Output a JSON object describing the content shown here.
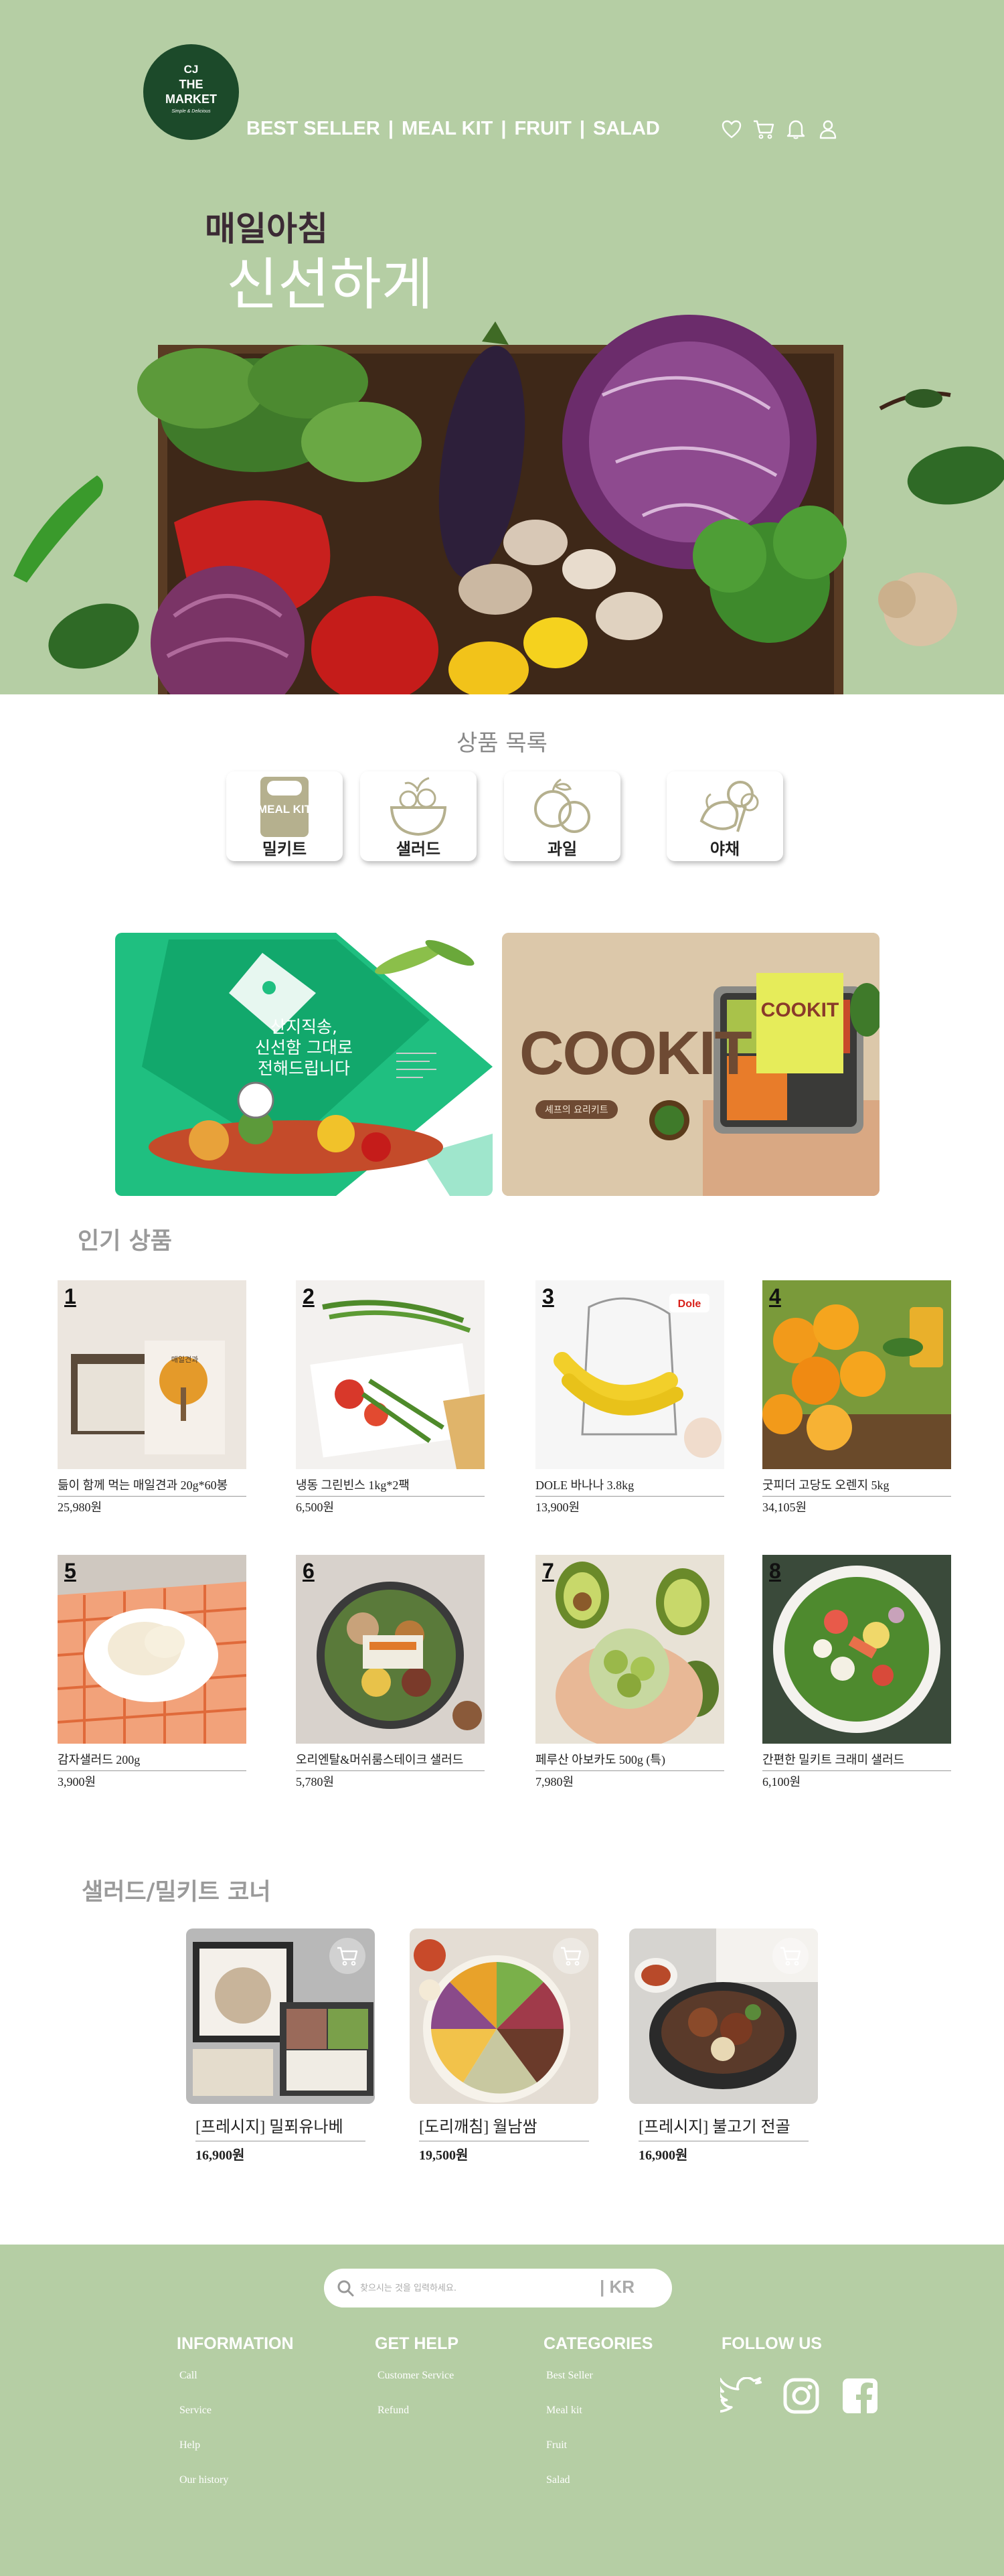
{
  "brand": {
    "line1": "CJ",
    "line2": "THE",
    "line3": "MARKET",
    "tagline": "Simple & Delicious"
  },
  "nav": {
    "items": [
      "BEST SELLER",
      "MEAL KIT",
      "FRUIT",
      "SALAD"
    ],
    "separator": "|"
  },
  "header_icons": [
    "heart-icon",
    "cart-icon",
    "bell-icon",
    "user-icon"
  ],
  "hero": {
    "line1": "매일아침",
    "line2": "신선하게"
  },
  "categories": {
    "title": "상품 목록",
    "items": [
      {
        "label": "밀키트",
        "icon": "meal-kit-icon",
        "icon_text": "MEAL KIT"
      },
      {
        "label": "샐러드",
        "icon": "salad-bowl-icon"
      },
      {
        "label": "과일",
        "icon": "fruit-icon"
      },
      {
        "label": "야채",
        "icon": "vegetable-icon"
      }
    ]
  },
  "banners": {
    "left": {
      "lines": [
        "산지직송,",
        "신선함 그대로",
        "전해드립니다"
      ]
    },
    "right": {
      "title": "COOKIT",
      "subtitle": "셰프의 요리키트",
      "pack_label": "COOKIT"
    }
  },
  "popular": {
    "title": "인기 상품",
    "items": [
      {
        "rank": "1",
        "name": "듦이 함께 먹는 매일견과 20g*60봉",
        "price": "25,980원",
        "img_label": "매일견과"
      },
      {
        "rank": "2",
        "name": "냉동 그린빈스 1kg*2팩",
        "price": "6,500원"
      },
      {
        "rank": "3",
        "name": "DOLE 바나나 3.8kg",
        "price": "13,900원",
        "img_label": "Dole"
      },
      {
        "rank": "4",
        "name": "굿피더 고당도 오렌지 5kg",
        "price": "34,105원"
      },
      {
        "rank": "5",
        "name": "감자샐러드 200g",
        "price": "3,900원"
      },
      {
        "rank": "6",
        "name": "오리엔탈&머쉬룸스테이크 샐러드",
        "price": "5,780원"
      },
      {
        "rank": "7",
        "name": "페루산 아보카도 500g (특)",
        "price": "7,980원"
      },
      {
        "rank": "8",
        "name": "간편한 밀키트 크래미 샐러드",
        "price": "6,100원"
      }
    ]
  },
  "kits": {
    "title": "샐러드/밀키트 코너",
    "items": [
      {
        "name": "[프레시지] 밀푀유나베",
        "price": "16,900원"
      },
      {
        "name": "[도리깨침] 월남쌈",
        "price": "19,500원"
      },
      {
        "name": "[프레시지] 불고기 전골",
        "price": "16,900원"
      }
    ]
  },
  "footer": {
    "search_placeholder": "찾으시는 것을 입력하세요.",
    "lang": "| KR",
    "columns": [
      {
        "heading": "INFORMATION",
        "links": [
          "Call",
          "Service",
          "Help",
          "Our history"
        ]
      },
      {
        "heading": "GET HELP",
        "links": [
          "Customer Service",
          "Refund"
        ]
      },
      {
        "heading": "CATEGORIES",
        "links": [
          "Best Seller",
          "Meal kit",
          "Fruit",
          "Salad"
        ]
      },
      {
        "heading": "FOLLOW US",
        "links": []
      }
    ],
    "social": [
      "twitter-icon",
      "instagram-icon",
      "facebook-icon"
    ]
  },
  "colors": {
    "brand_green": "#1c4a2a",
    "sage": "#b5cea4",
    "banner_green": "#1fbf80"
  }
}
